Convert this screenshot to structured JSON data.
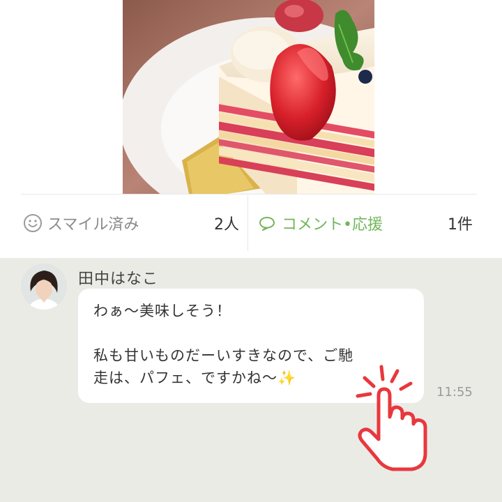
{
  "post": {
    "photo_alt": "strawberry shortcake"
  },
  "actions": {
    "smile": {
      "label": "スマイル済み",
      "count": "2人",
      "icon": "smile-icon"
    },
    "comment": {
      "label": "コメント•応援",
      "count": "1件",
      "icon": "speech-bubble-icon"
    }
  },
  "comment": {
    "author": "田中はなこ",
    "line1": "わぁ〜美味しそう！",
    "line2": "私も甘いものだーいすきなので、ご馳",
    "line3": "走は、パフェ、ですかね〜",
    "emoji": "✨",
    "time": "11:55"
  },
  "colors": {
    "accent_green": "#72b55a",
    "tap_red": "#e8383d",
    "comment_bg": "#ebebe6"
  }
}
